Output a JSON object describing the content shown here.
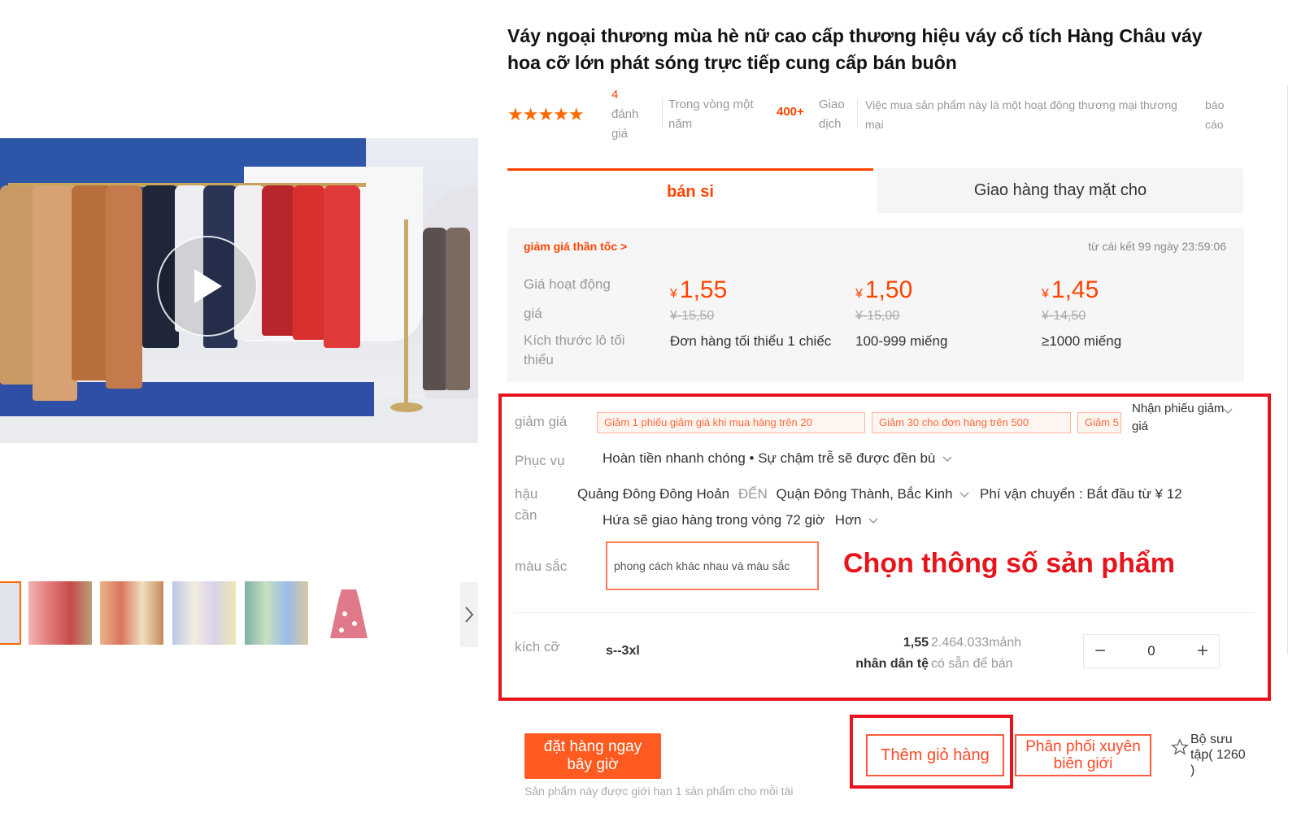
{
  "product": {
    "title": "Váy ngoại thương mùa hè nữ cao cấp thương hiệu váy cổ tích Hàng Châu váy hoa cỡ lớn phát sóng trực tiếp cung cấp bán buôn"
  },
  "stats": {
    "stars": "★★★★★",
    "review_count": "4",
    "review_label": "đánh giá",
    "period": "Trong vòng một năm",
    "deal_count": "400+",
    "deal_label": "Giao dịch",
    "trade_note": "Việc mua sản phẩm này là một hoạt động thương mại thương mại",
    "report": "báo cáo"
  },
  "tabs": {
    "wholesale": "bán si",
    "dropship": "Giao hàng thay mặt cho"
  },
  "price_box": {
    "promo_link": "giảm giá thần tốc >",
    "countdown": "từ cái kết 99 ngày 23:59:06",
    "label_activity": "Giá hoạt động",
    "label_price": "giá",
    "label_min_batch": "Kích thước lô tối thiểu",
    "currency": "¥",
    "tiers": [
      {
        "price": "1,55",
        "original": "¥-15,50",
        "qty": "Đơn hàng tối thiểu 1 chiếc"
      },
      {
        "price": "1,50",
        "original": "¥-15,00",
        "qty": "100-999 miếng"
      },
      {
        "price": "1,45",
        "original": "¥-14,50",
        "qty": "≥1000 miếng"
      }
    ]
  },
  "sku": {
    "discount_label": "giảm giá",
    "coupons": [
      "Giảm 1 phiếu giảm giá khi mua hàng trên 20",
      "Giảm 30 cho đơn hàng trên 500",
      "Giảm 5"
    ],
    "coupon_receive": "Nhận phiếu giảm giá",
    "service_label": "Phục vụ",
    "service_text": "Hoàn tiền nhanh chóng • Sự chậm trễ sẽ được đền bù",
    "logistics_label": "hậu cần",
    "ship_from": "Quảng Đông Đông Hoản",
    "ship_to_word": "ĐẾN",
    "ship_to": "Quận Đông Thành, Bắc Kinh",
    "shipping_fee": "Phí vận chuyển : Bắt đầu từ ¥ 12",
    "delivery_promise": "Hứa sẽ giao hàng trong vòng 72 giờ",
    "more": "Hơn",
    "color_label": "màu sắc",
    "color_option": "phong cách khác nhau và màu sắc",
    "callout": "Chọn thông số sản phẩm",
    "size_label": "kích cỡ",
    "size_value": "s--3xl",
    "unit_price": "1,55",
    "unit_currency": "nhân dân tệ",
    "stock_count": "2.464.033mảnh",
    "stock_label": "có sẵn để bán",
    "quantity": "0",
    "minus": "−",
    "plus": "+"
  },
  "actions": {
    "order_now": "đặt hàng ngay bây giờ",
    "add_to_cart": "Thêm giỏ hàng",
    "cross_border": "Phân phối xuyên biên giới",
    "collection": "Bộ sưu tập( 1260 )",
    "order_note": "Sản phẩm này được giới hạn 1 sản phẩm cho mỗi tài"
  },
  "colors": {
    "accent": "#ff4400",
    "highlight_red": "#e8141b",
    "order_button": "#ff5a1f",
    "price_box_bg": "#f6f6f7"
  },
  "icons": {
    "play": "play-icon",
    "star": "star-icon",
    "chevron_down": "chevron-down-icon",
    "chevron_right": "chevron-right-icon",
    "star_outline": "star-outline-icon"
  }
}
